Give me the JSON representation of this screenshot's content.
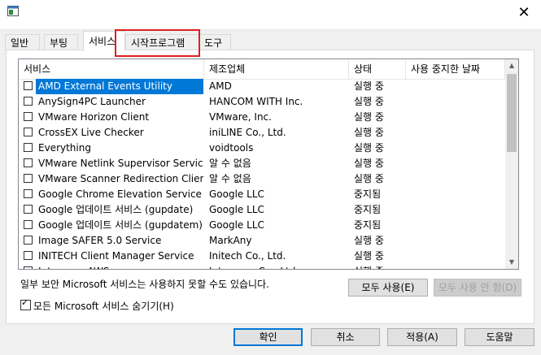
{
  "window": {
    "close_glyph": "✕"
  },
  "tabs": [
    "일반",
    "부팅",
    "서비스",
    "시작프로그램",
    "도구"
  ],
  "listview": {
    "columns": [
      "서비스",
      "제조업체",
      "상태",
      "사용 중지한 날짜"
    ],
    "rows": [
      {
        "name": "AMD External Events Utility",
        "maker": "AMD",
        "status": "실행 중",
        "selected": true
      },
      {
        "name": "AnySign4PC Launcher",
        "maker": "HANCOM WITH Inc.",
        "status": "실행 중"
      },
      {
        "name": "VMware Horizon Client",
        "maker": "VMware, Inc.",
        "status": "실행 중"
      },
      {
        "name": "CrossEX Live Checker",
        "maker": "iniLINE Co., Ltd.",
        "status": "실행 중"
      },
      {
        "name": "Everything",
        "maker": "voidtools",
        "status": "실행 중"
      },
      {
        "name": "VMware Netlink Supervisor Service",
        "maker": "알 수 없음",
        "status": "실행 중"
      },
      {
        "name": "VMware Scanner Redirection Client",
        "maker": "알 수 없음",
        "status": "실행 중"
      },
      {
        "name": "Google Chrome Elevation Service",
        "maker": "Google LLC",
        "status": "중지됨"
      },
      {
        "name": "Google 업데이트 서비스 (gupdate)",
        "maker": "Google LLC",
        "status": "중지됨"
      },
      {
        "name": "Google 업데이트 서비스 (gupdatem)",
        "maker": "Google LLC",
        "status": "중지됨"
      },
      {
        "name": "Image SAFER 5.0 Service",
        "maker": "MarkAny",
        "status": "실행 중"
      },
      {
        "name": "INITECH Client Manager Service",
        "maker": "Initech Co., Ltd.",
        "status": "실행 중"
      },
      {
        "name": "Interezen AWS",
        "maker": "Interezen Co., Ltd.",
        "status": "실행 중"
      }
    ]
  },
  "note": "일부 보안 Microsoft 서비스는 사용하지 못할 수도 있습니다.",
  "enable_all": "모두 사용(E)",
  "disable_all": "모두 사용 안 함(D)",
  "hide_ms": "모든 Microsoft 서비스 숨기기(H)",
  "hide_ms_checked": true,
  "footer": {
    "ok": "확인",
    "cancel": "취소",
    "apply": "적용(A)",
    "help": "도움말"
  },
  "colors": {
    "selection": "#0078d7",
    "highlight": "#e02020"
  },
  "icons": {
    "scroll_up": "scroll-up-icon",
    "scroll_down": "scroll-down-icon",
    "app": "msconfig-icon"
  }
}
